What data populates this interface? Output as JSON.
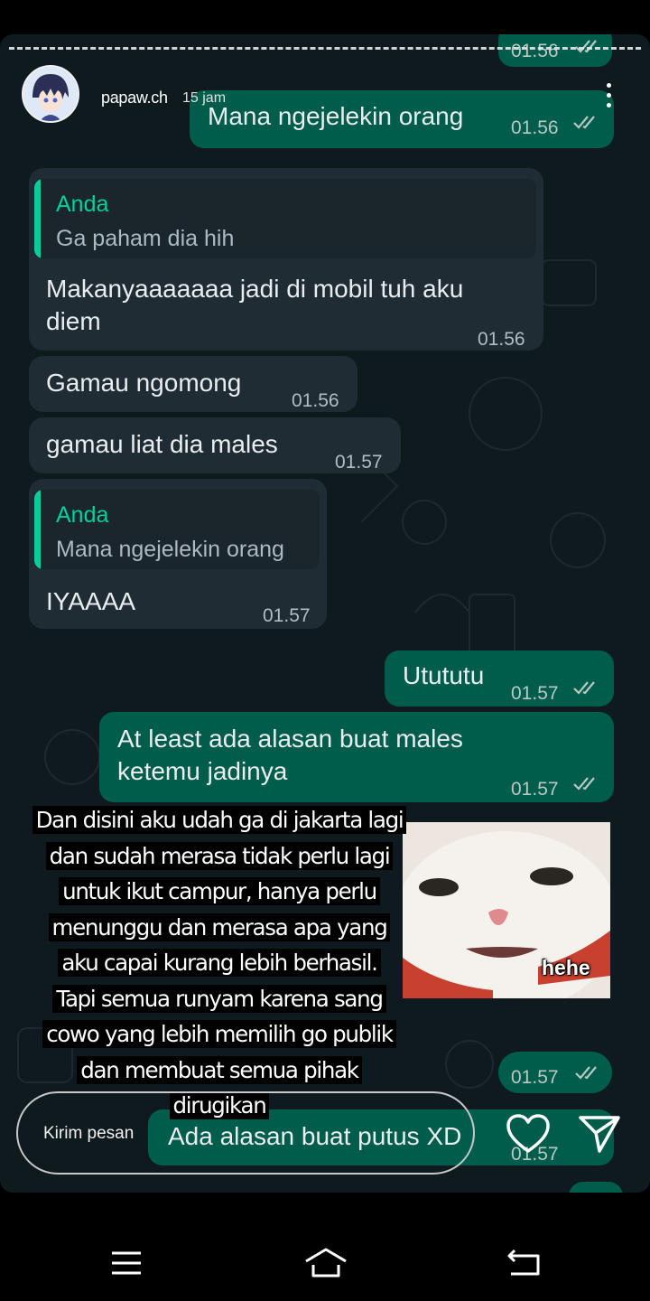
{
  "story": {
    "username": "papaw.ch",
    "time_ago": "15 jam",
    "reply_placeholder": "Kirim pesan",
    "overlay_lines": [
      "Dan disini aku udah ga di jakarta lagi",
      "dan sudah merasa tidak perlu lagi",
      "untuk ikut campur, hanya perlu",
      "menunggu dan merasa apa yang",
      "aku capai kurang lebih berhasil.",
      "Tapi semua runyam karena sang",
      "cowo yang lebih memilih go publik",
      "dan membuat semua pihak",
      "dirugikan"
    ],
    "sticker_caption": "hehe"
  },
  "chat": {
    "top_partial_time": "01.56",
    "m1": {
      "text": "Mana ngejelekin orang",
      "time": "01.56"
    },
    "m2": {
      "quote_name": "Anda",
      "quote_text": "Ga paham dia hih",
      "line1": "Makanyaaaaaaa jadi di mobil tuh aku",
      "line2": "diem",
      "time": "01.56"
    },
    "m3": {
      "text": "Gamau ngomong",
      "time": "01.56"
    },
    "m4": {
      "text": "gamau liat dia males",
      "time": "01.57"
    },
    "m5": {
      "quote_name": "Anda",
      "quote_text": "Mana ngejelekin orang",
      "text": "IYAAAA",
      "time": "01.57"
    },
    "m6": {
      "text": "Utututu",
      "time": "01.57"
    },
    "m7": {
      "line1": "At least ada alasan buat males",
      "line2": "ketemu jadinya",
      "time": "01.57"
    },
    "m8": {
      "time": "01.57"
    },
    "m9": {
      "text": "Ada alasan buat putus XD",
      "time": "01.57"
    }
  },
  "colors": {
    "incoming": "#1f2c34",
    "outgoing": "#005c4b",
    "quote_accent": "#06cf9c",
    "background": "#0f1a1f"
  }
}
